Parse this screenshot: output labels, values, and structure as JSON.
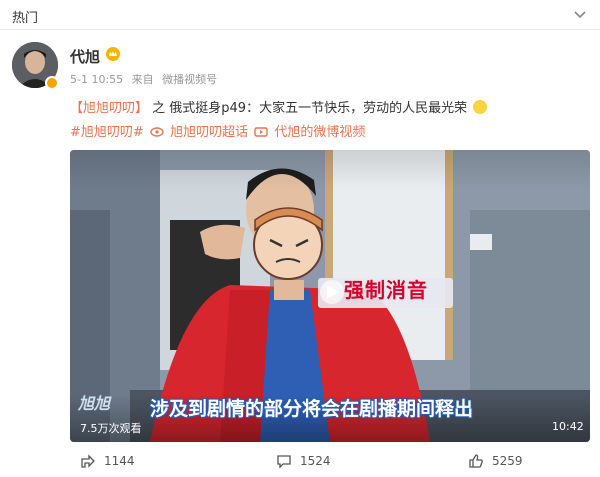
{
  "header": {
    "title": "热门",
    "chevron_icon": "chevron-down-icon"
  },
  "user": {
    "name": "代旭",
    "verified_badge_color": "#f7a400",
    "crown_icon": "crown-icon",
    "time": "5-1 10:55",
    "source_prefix": "来自",
    "source": "微播视频号"
  },
  "post": {
    "topic": "【旭旭叨叨】",
    "body": "之 俄式挺身p49：大家五一节快乐，劳动的人民最光荣",
    "emoji": "smile-emoji"
  },
  "tags": {
    "hashtag": "#旭旭叨叨#",
    "super_topic": "旭旭叨叨超话",
    "video_link": "代旭的微博视频"
  },
  "video": {
    "muted_label": "强制消音",
    "overlay_tag": "旭旭",
    "caption": "涉及到剧情的部分将会在剧播期间释出",
    "views": "7.5万次观看",
    "duration": "10:42",
    "accent_red": "#d8002a"
  },
  "actions": {
    "share_count": "1144",
    "comment_count": "1524",
    "like_count": "5259"
  }
}
